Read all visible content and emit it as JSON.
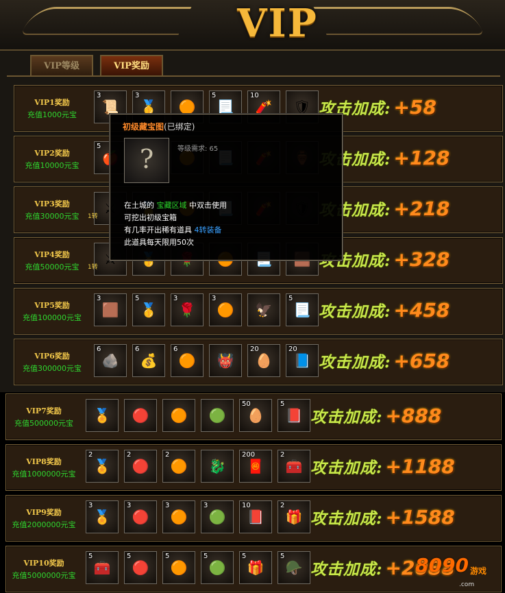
{
  "header": {
    "logo": "VIP"
  },
  "tabs": [
    {
      "label": "VIP等级"
    },
    {
      "label": "VIP奖励"
    }
  ],
  "rows": [
    {
      "name": "VIP1奖励",
      "req": "充值1000元宝",
      "bonus_label": "攻击加成:",
      "bonus_value": "+58",
      "items": [
        {
          "qty": "3",
          "icon": "treasure-map"
        },
        {
          "qty": "3",
          "icon": "gold-ingot"
        },
        {
          "qty": "",
          "icon": "golden-orb"
        },
        {
          "qty": "5",
          "icon": "scroll"
        },
        {
          "qty": "10",
          "icon": "firework"
        },
        {
          "qty": "",
          "icon": "armor"
        }
      ]
    },
    {
      "name": "VIP2奖励",
      "req": "充值10000元宝",
      "bonus_label": "攻击加成:",
      "bonus_value": "+128",
      "items": [
        {
          "qty": "5",
          "icon": "red-fruit"
        },
        {
          "qty": "",
          "icon": "gold-ingot"
        },
        {
          "qty": "",
          "icon": "golden-orb"
        },
        {
          "qty": "",
          "icon": "scroll"
        },
        {
          "qty": "",
          "icon": "firework"
        },
        {
          "qty": "",
          "icon": "treasure-bowl"
        }
      ]
    },
    {
      "name": "VIP3奖励",
      "req": "充值30000元宝",
      "bonus_label": "攻击加成:",
      "bonus_value": "+218",
      "turn": "1转",
      "items": [
        {
          "qty": "",
          "icon": "weapon"
        },
        {
          "qty": "",
          "icon": "gold-ingot"
        },
        {
          "qty": "",
          "icon": "golden-orb"
        },
        {
          "qty": "",
          "icon": "scroll"
        },
        {
          "qty": "",
          "icon": "firework"
        },
        {
          "qty": "",
          "icon": "armor"
        }
      ]
    },
    {
      "name": "VIP4奖励",
      "req": "充值50000元宝",
      "bonus_label": "攻击加成:",
      "bonus_value": "+328",
      "turn": "1转",
      "items": [
        {
          "qty": "",
          "icon": "weapon"
        },
        {
          "qty": "",
          "icon": "gold-ingot"
        },
        {
          "qty": "",
          "icon": "red-rose"
        },
        {
          "qty": "",
          "icon": "golden-orb"
        },
        {
          "qty": "",
          "icon": "scroll"
        },
        {
          "qty": "",
          "icon": "gold-bars"
        }
      ]
    },
    {
      "name": "VIP5奖励",
      "req": "充值100000元宝",
      "bonus_label": "攻击加成:",
      "bonus_value": "+458",
      "items": [
        {
          "qty": "3",
          "icon": "gold-bars"
        },
        {
          "qty": "5",
          "icon": "gold-ingot"
        },
        {
          "qty": "3",
          "icon": "red-rose"
        },
        {
          "qty": "3",
          "icon": "golden-orb"
        },
        {
          "qty": "",
          "icon": "phoenix"
        },
        {
          "qty": "5",
          "icon": "scroll"
        }
      ]
    },
    {
      "name": "VIP6奖励",
      "req": "充值300000元宝",
      "bonus_label": "攻击加成:",
      "bonus_value": "+658",
      "items": [
        {
          "qty": "6",
          "icon": "stone-tablet"
        },
        {
          "qty": "6",
          "icon": "treasure-pile"
        },
        {
          "qty": "6",
          "icon": "golden-orb"
        },
        {
          "qty": "",
          "icon": "dark-warrior"
        },
        {
          "qty": "20",
          "icon": "golden-egg"
        },
        {
          "qty": "20",
          "icon": "blue-book"
        }
      ]
    },
    {
      "name": "VIP7奖励",
      "req": "充值500000元宝",
      "bonus_label": "攻击加成:",
      "bonus_value": "+888",
      "items": [
        {
          "qty": "",
          "icon": "gold-medal"
        },
        {
          "qty": "",
          "icon": "red-orb"
        },
        {
          "qty": "",
          "icon": "golden-orb"
        },
        {
          "qty": "",
          "icon": "jade-ring"
        },
        {
          "qty": "50",
          "icon": "golden-egg"
        },
        {
          "qty": "5",
          "icon": "purple-book"
        }
      ]
    },
    {
      "name": "VIP8奖励",
      "req": "充值1000000元宝",
      "bonus_label": "攻击加成:",
      "bonus_value": "+1188",
      "items": [
        {
          "qty": "2",
          "icon": "gold-medal"
        },
        {
          "qty": "2",
          "icon": "red-orb"
        },
        {
          "qty": "2",
          "icon": "golden-orb"
        },
        {
          "qty": "",
          "icon": "golden-dragon"
        },
        {
          "qty": "200",
          "icon": "green-scroll"
        },
        {
          "qty": "2",
          "icon": "treasure-chest"
        }
      ]
    },
    {
      "name": "VIP9奖励",
      "req": "充值2000000元宝",
      "bonus_label": "攻击加成:",
      "bonus_value": "+1588",
      "items": [
        {
          "qty": "3",
          "icon": "gold-medal"
        },
        {
          "qty": "3",
          "icon": "red-orb"
        },
        {
          "qty": "3",
          "icon": "golden-orb"
        },
        {
          "qty": "3",
          "icon": "jade-ring"
        },
        {
          "qty": "10",
          "icon": "purple-book"
        },
        {
          "qty": "2",
          "icon": "gift-box"
        }
      ]
    },
    {
      "name": "VIP10奖励",
      "req": "充值5000000元宝",
      "bonus_label": "攻击加成:",
      "bonus_value": "+2088",
      "items": [
        {
          "qty": "5",
          "icon": "treasure-chest"
        },
        {
          "qty": "5",
          "icon": "red-orb"
        },
        {
          "qty": "5",
          "icon": "golden-orb"
        },
        {
          "qty": "5",
          "icon": "jade-ring"
        },
        {
          "qty": "5",
          "icon": "gift-box"
        },
        {
          "qty": "5",
          "icon": "silver-armor"
        }
      ]
    }
  ],
  "tooltip": {
    "name": "初级藏宝图",
    "bind": "(已绑定)",
    "icon": "treasure-map-unknown-icon",
    "icon_glyph": "?",
    "level_req": "等级需求: 65",
    "desc": [
      [
        {
          "text": "在土城的 ",
          "cls": ""
        },
        {
          "text": "宝藏区域",
          "cls": "c-green"
        },
        {
          "text": " 中双击使用",
          "cls": ""
        }
      ],
      [
        {
          "text": "可挖出初级宝箱",
          "cls": ""
        }
      ],
      [
        {
          "text": "有几率开出稀有道具 ",
          "cls": ""
        },
        {
          "text": "4转装备",
          "cls": "c-blue"
        }
      ],
      [
        {
          "text": "此道具每天限用50次",
          "cls": ""
        }
      ]
    ]
  },
  "watermark": {
    "number": "8090",
    "game": "游戏",
    "domain": ".com"
  },
  "icon_glyphs": {
    "treasure-map": "📜",
    "gold-ingot": "🥇",
    "golden-orb": "🟠",
    "scroll": "📃",
    "firework": "🧨",
    "armor": "🛡",
    "red-fruit": "🍎",
    "treasure-bowl": "🏺",
    "weapon": "⚔",
    "red-rose": "🌹",
    "gold-bars": "🟫",
    "phoenix": "🦅",
    "stone-tablet": "🪨",
    "treasure-pile": "💰",
    "dark-warrior": "👹",
    "golden-egg": "🥚",
    "blue-book": "📘",
    "gold-medal": "🏅",
    "red-orb": "🔴",
    "jade-ring": "🟢",
    "purple-book": "📕",
    "golden-dragon": "🐉",
    "green-scroll": "🧧",
    "treasure-chest": "🧰",
    "gift-box": "🎁",
    "silver-armor": "🪖"
  }
}
